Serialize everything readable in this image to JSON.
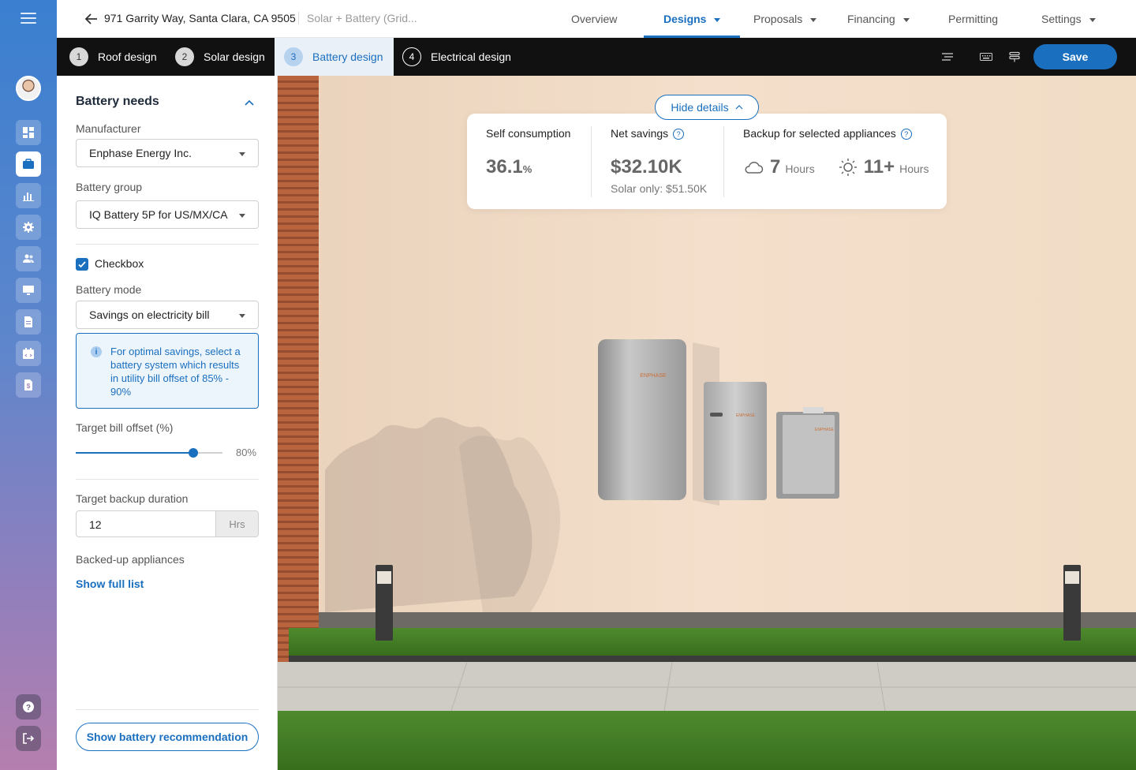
{
  "rail": {
    "items": [
      "dashboard-icon",
      "briefcase-icon",
      "chart-icon",
      "gear-icon",
      "users-icon",
      "monitor-icon",
      "document-icon",
      "calendar-icon",
      "file-dollar-icon"
    ],
    "bottom": [
      "help-icon",
      "logout-icon"
    ]
  },
  "header": {
    "address": "971 Garrity Way, Santa Clara, CA 9505",
    "project": "Solar + Battery (Grid...",
    "nav": [
      {
        "label": "Overview",
        "dropdown": false
      },
      {
        "label": "Designs",
        "dropdown": true,
        "active": true
      },
      {
        "label": "Proposals",
        "dropdown": true
      },
      {
        "label": "Financing",
        "dropdown": true
      },
      {
        "label": "Permitting",
        "dropdown": false
      },
      {
        "label": "Settings",
        "dropdown": true
      }
    ]
  },
  "steps": [
    {
      "num": "1",
      "label": "Roof design"
    },
    {
      "num": "2",
      "label": "Solar design"
    },
    {
      "num": "3",
      "label": "Battery design",
      "active": true
    },
    {
      "num": "4",
      "label": "Electrical design"
    }
  ],
  "toolbar": {
    "save_label": "Save"
  },
  "panel": {
    "title": "Battery needs",
    "manufacturer": {
      "label": "Manufacturer",
      "value": "Enphase Energy Inc."
    },
    "battery_group": {
      "label": "Battery group",
      "value": "IQ Battery 5P for US/MX/CA"
    },
    "checkbox": {
      "label": "Checkbox",
      "checked": true
    },
    "battery_mode": {
      "label": "Battery mode",
      "value": "Savings on electricity bill"
    },
    "info": "For optimal savings, select a battery system which results in utility bill offset of 85% - 90%",
    "target_offset": {
      "label": "Target bill offset (%)",
      "value_text": "80%",
      "fraction": 0.8
    },
    "backup": {
      "label": "Target backup duration",
      "value": "12",
      "unit": "Hrs"
    },
    "appliances": {
      "label": "Backed-up appliances",
      "link": "Show full list"
    },
    "recommend_btn": "Show battery recommendation"
  },
  "details": {
    "hide_label": "Hide details",
    "self_consumption": {
      "title": "Self consumption",
      "value": "36.1",
      "unit": "%"
    },
    "net_savings": {
      "title": "Net savings",
      "value": "$32.10K",
      "sub": "Solar only: $51.50K"
    },
    "backup": {
      "title": "Backup for selected appliances",
      "cloudy": "7",
      "sunny": "11+",
      "unit": "Hours"
    }
  },
  "scene": {
    "brand": "ENPHASE"
  },
  "colors": {
    "accent": "#1a6fbf",
    "stepbar": "#111111",
    "wall": "#f0d9c2"
  }
}
